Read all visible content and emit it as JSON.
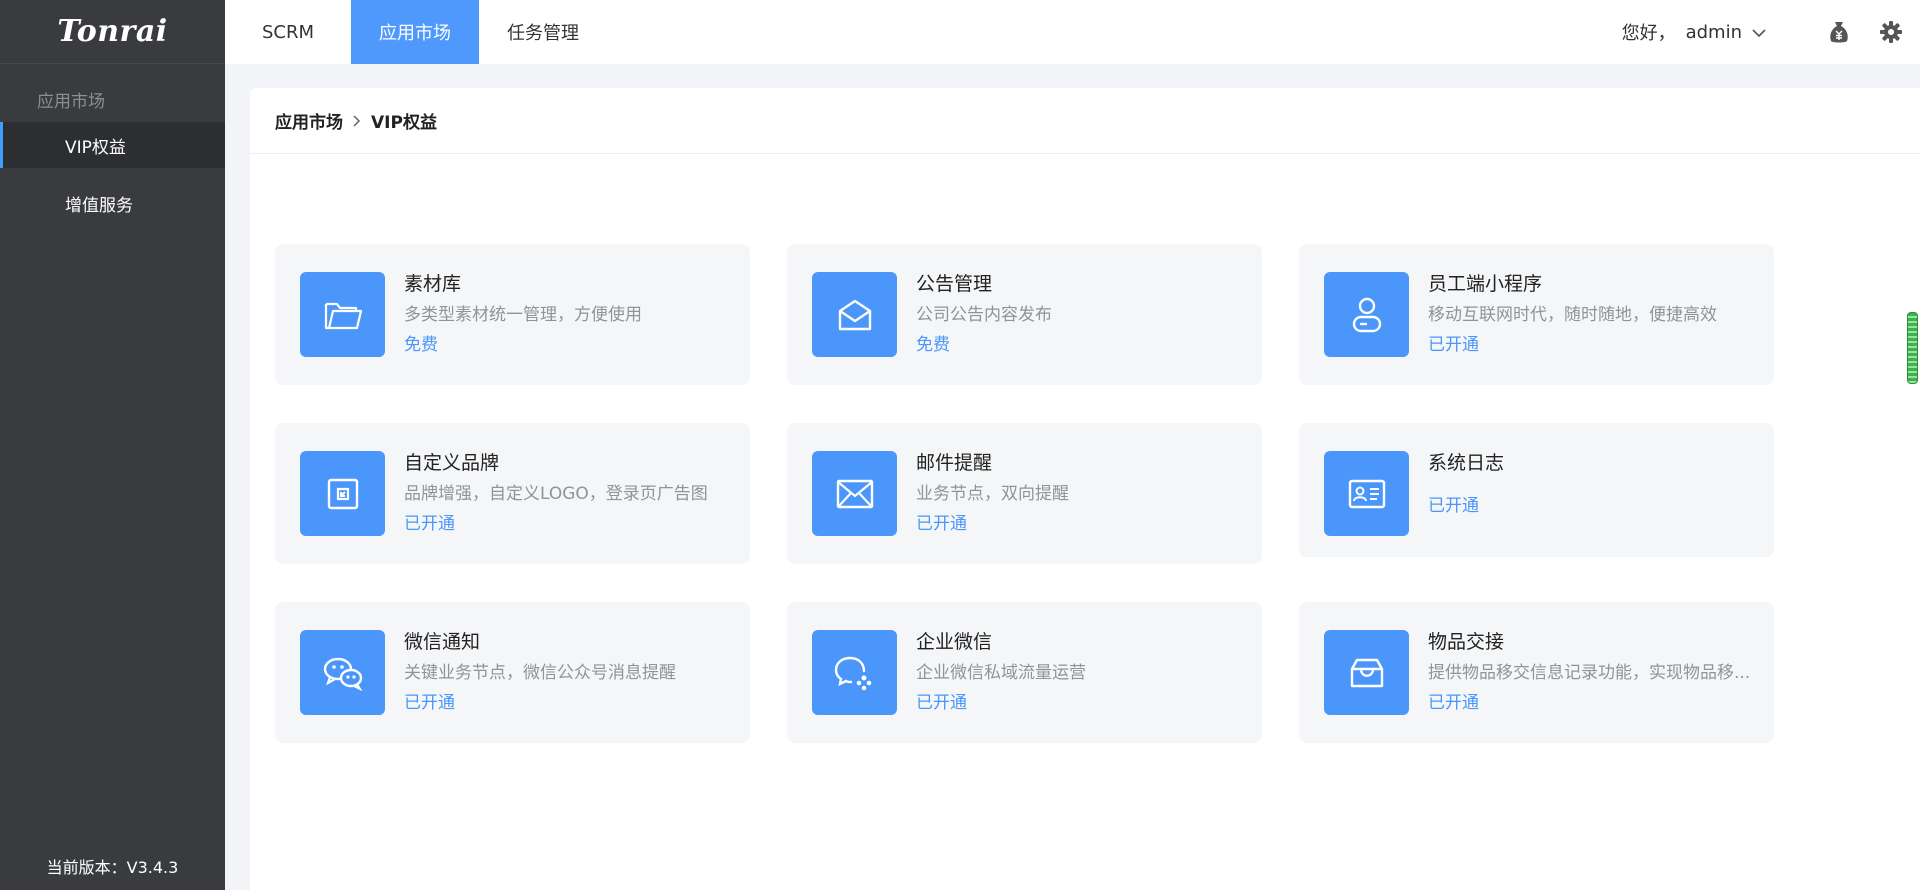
{
  "app": {
    "logo": "Tonrai",
    "logo_mark": "…"
  },
  "sidebar": {
    "group": "应用市场",
    "items": [
      {
        "label": "VIP权益",
        "active": true
      },
      {
        "label": "增值服务",
        "active": false
      }
    ],
    "version": "当前版本：V3.4.3"
  },
  "topbar": {
    "tabs": [
      {
        "label": "SCRM",
        "active": false
      },
      {
        "label": "应用市场",
        "active": true
      },
      {
        "label": "任务管理",
        "active": false
      }
    ],
    "greeting": "您好，",
    "user": "admin",
    "icons": [
      "money-bag-icon",
      "gear-icon"
    ]
  },
  "breadcrumb": {
    "items": [
      "应用市场",
      "VIP权益"
    ]
  },
  "cards": [
    {
      "title": "素材库",
      "desc": "多类型素材统一管理，方便使用",
      "status": "免费",
      "icon": "folder-icon"
    },
    {
      "title": "公告管理",
      "desc": "公司公告内容发布",
      "status": "免费",
      "icon": "envelope-open-icon"
    },
    {
      "title": "员工端小程序",
      "desc": "移动互联网时代，随时随地，便捷高效",
      "status": "已开通",
      "icon": "user-icon"
    },
    {
      "title": "自定义品牌",
      "desc": "品牌增强，自定义LOGO，登录页广告图",
      "status": "已开通",
      "icon": "brand-icon"
    },
    {
      "title": "邮件提醒",
      "desc": "业务节点，双向提醒",
      "status": "已开通",
      "icon": "mail-icon"
    },
    {
      "title": "系统日志",
      "desc": "",
      "status": "已开通",
      "icon": "id-card-icon"
    },
    {
      "title": "微信通知",
      "desc": "关键业务节点，微信公众号消息提醒",
      "status": "已开通",
      "icon": "wechat-icon"
    },
    {
      "title": "企业微信",
      "desc": "企业微信私域流量运营",
      "status": "已开通",
      "icon": "enterprise-wechat-icon"
    },
    {
      "title": "物品交接",
      "desc": "提供物品移交信息记录功能，实现物品移...",
      "status": "已开通",
      "icon": "box-icon"
    }
  ],
  "colors": {
    "accent": "#4a96fb",
    "sidebar_bg": "#3a3b3f",
    "active_tab": "#4f98fc"
  }
}
